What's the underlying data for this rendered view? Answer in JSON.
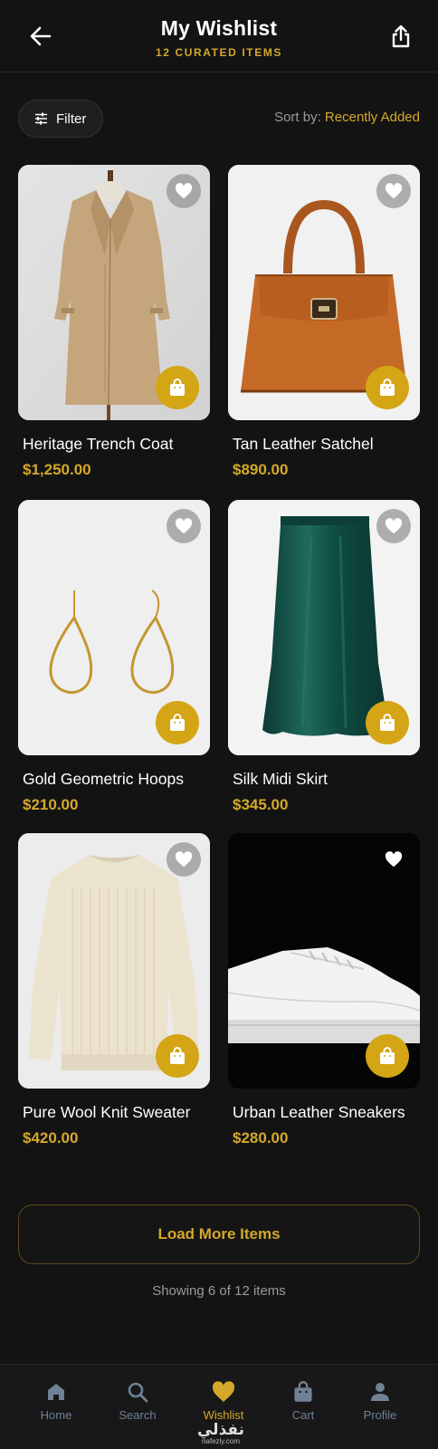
{
  "header": {
    "title": "My Wishlist",
    "subtitle": "12 CURATED ITEMS"
  },
  "toolbar": {
    "filter_label": "Filter",
    "sort_prefix": "Sort by:",
    "sort_value": "Recently Added"
  },
  "products": [
    {
      "name": "Heritage Trench Coat",
      "price": "$1,250.00",
      "image": "trench-coat-on-mannequin"
    },
    {
      "name": "Tan Leather Satchel",
      "price": "$890.00",
      "image": "tan-leather-handbag"
    },
    {
      "name": "Gold Geometric Hoops",
      "price": "$210.00",
      "image": "gold-teardrop-earrings"
    },
    {
      "name": "Silk Midi Skirt",
      "price": "$345.00",
      "image": "emerald-satin-skirt"
    },
    {
      "name": "Pure Wool Knit Sweater",
      "price": "$420.00",
      "image": "cream-knit-sweater"
    },
    {
      "name": "Urban Leather Sneakers",
      "price": "$280.00",
      "image": "white-leather-sneaker"
    }
  ],
  "load_more_label": "Load More Items",
  "showing_text": "Showing 6 of 12 items",
  "nav": {
    "items": [
      {
        "label": "Home",
        "icon": "home-icon"
      },
      {
        "label": "Search",
        "icon": "search-icon"
      },
      {
        "label": "Wishlist",
        "icon": "heart-icon",
        "active": true
      },
      {
        "label": "Cart",
        "icon": "shopping-bag-icon"
      },
      {
        "label": "Profile",
        "icon": "user-icon"
      }
    ]
  },
  "watermark": {
    "arabic": "نفذلي",
    "latin": "nafezly.com"
  },
  "colors": {
    "accent": "#d4a82a",
    "background": "#131313",
    "cart_button": "#d4a514"
  }
}
